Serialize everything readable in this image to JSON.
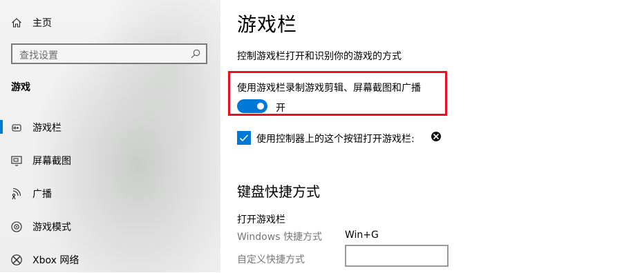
{
  "sidebar": {
    "home_label": "主页",
    "search_placeholder": "查找设置",
    "section_header": "游戏",
    "items": [
      {
        "label": "游戏栏",
        "icon": "game-bar-icon",
        "selected": true
      },
      {
        "label": "屏幕截图",
        "icon": "capture-icon",
        "selected": false
      },
      {
        "label": "广播",
        "icon": "broadcast-icon",
        "selected": false
      },
      {
        "label": "游戏模式",
        "icon": "game-mode-icon",
        "selected": false
      },
      {
        "label": "Xbox 网络",
        "icon": "xbox-icon",
        "selected": false
      }
    ]
  },
  "main": {
    "title": "游戏栏",
    "description": "控制游戏栏打开和识别你的游戏的方式",
    "record_toggle": {
      "label": "使用游戏栏录制游戏剪辑、屏幕截图和广播",
      "state_label": "开",
      "on": true
    },
    "controller_checkbox": {
      "label": "使用控制器上的这个按钮打开游戏栏:",
      "checked": true,
      "icon": "xbox-logo-icon"
    },
    "keyboard_section": {
      "title": "键盘快捷方式",
      "open_bar_heading": "打开游戏栏",
      "windows_shortcut_label": "Windows 快捷方式",
      "windows_shortcut_value": "Win+G",
      "custom_shortcut_label": "自定义快捷方式",
      "custom_shortcut_value": ""
    }
  },
  "colors": {
    "accent": "#0078d7",
    "highlight_border": "#e81123"
  }
}
